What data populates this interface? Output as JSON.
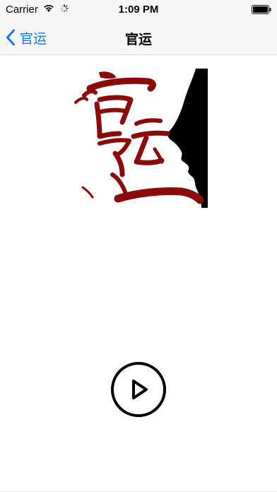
{
  "status_bar": {
    "carrier": "Carrier",
    "time": "1:09 PM",
    "icons": [
      "wifi-icon",
      "loading-spinner-icon",
      "battery-icon"
    ]
  },
  "nav_bar": {
    "back_label": "官运",
    "title": "官运"
  },
  "cover": {
    "calligraphy_text": "官运",
    "colors": {
      "ink": "#8b0a0a",
      "silhouette": "#000000",
      "background": "#ffffff"
    }
  },
  "player": {
    "play_icon": "play-icon"
  },
  "colors": {
    "accent": "#1677ff",
    "bar_background": "#f7f7f7"
  }
}
